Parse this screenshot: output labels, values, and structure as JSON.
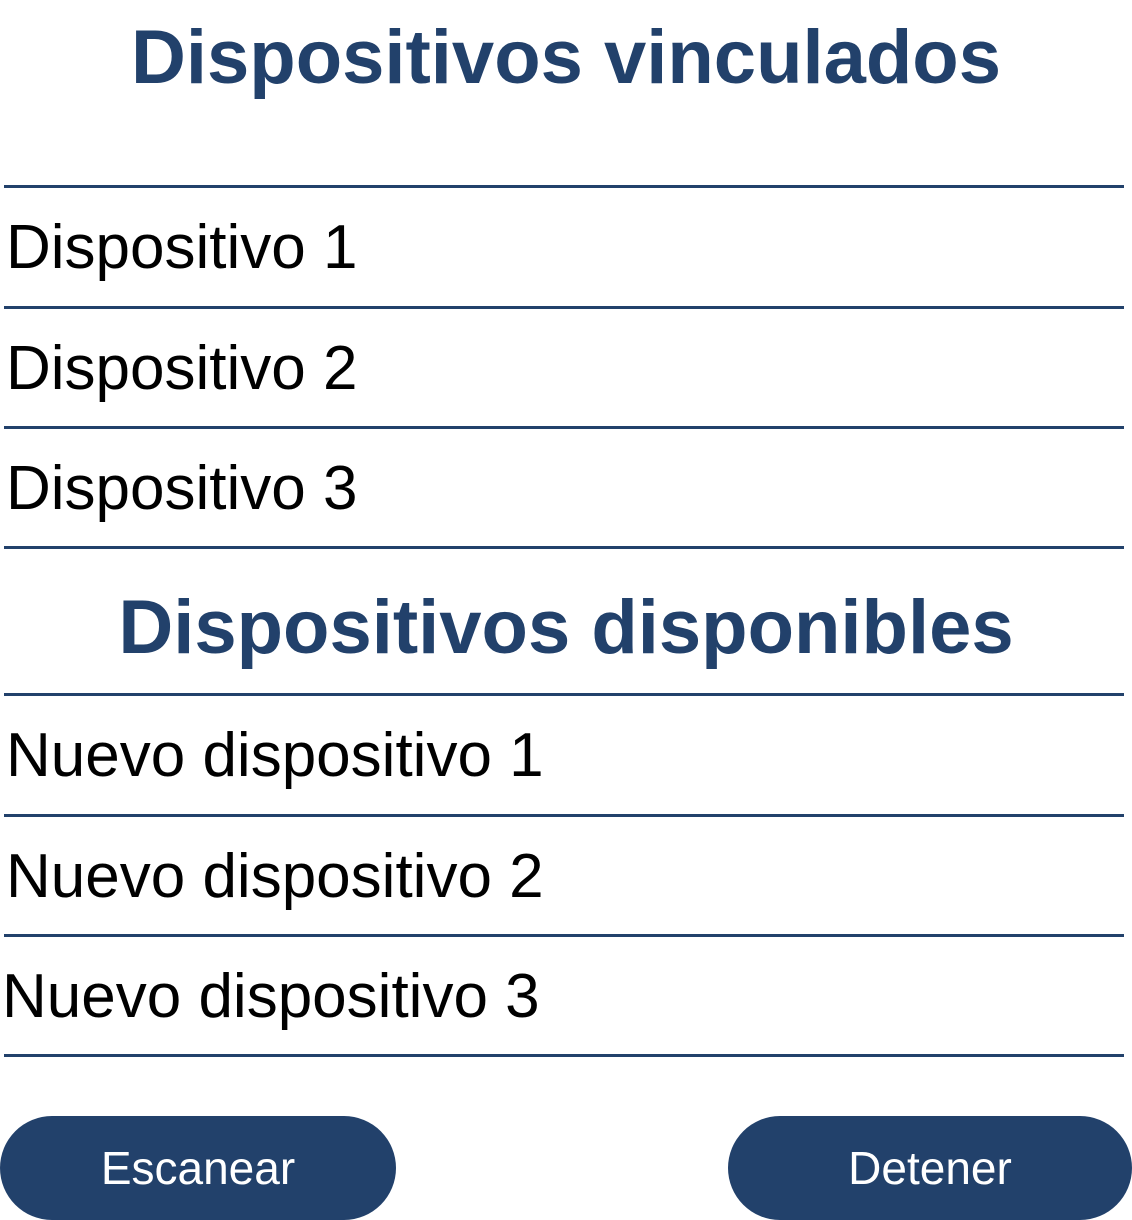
{
  "colors": {
    "accent": "#22416b",
    "text": "#000000",
    "background": "#ffffff",
    "button_text": "#ffffff"
  },
  "linked": {
    "title": "Dispositivos vinculados",
    "items": [
      {
        "label": "Dispositivo 1"
      },
      {
        "label": "Dispositivo 2"
      },
      {
        "label": "Dispositivo 3"
      }
    ]
  },
  "available": {
    "title": "Dispositivos disponibles",
    "items": [
      {
        "label": "Nuevo dispositivo 1"
      },
      {
        "label": "Nuevo dispositivo 2"
      },
      {
        "label": "Nuevo dispositivo 3"
      }
    ]
  },
  "actions": {
    "scan_label": "Escanear",
    "stop_label": "Detener"
  }
}
